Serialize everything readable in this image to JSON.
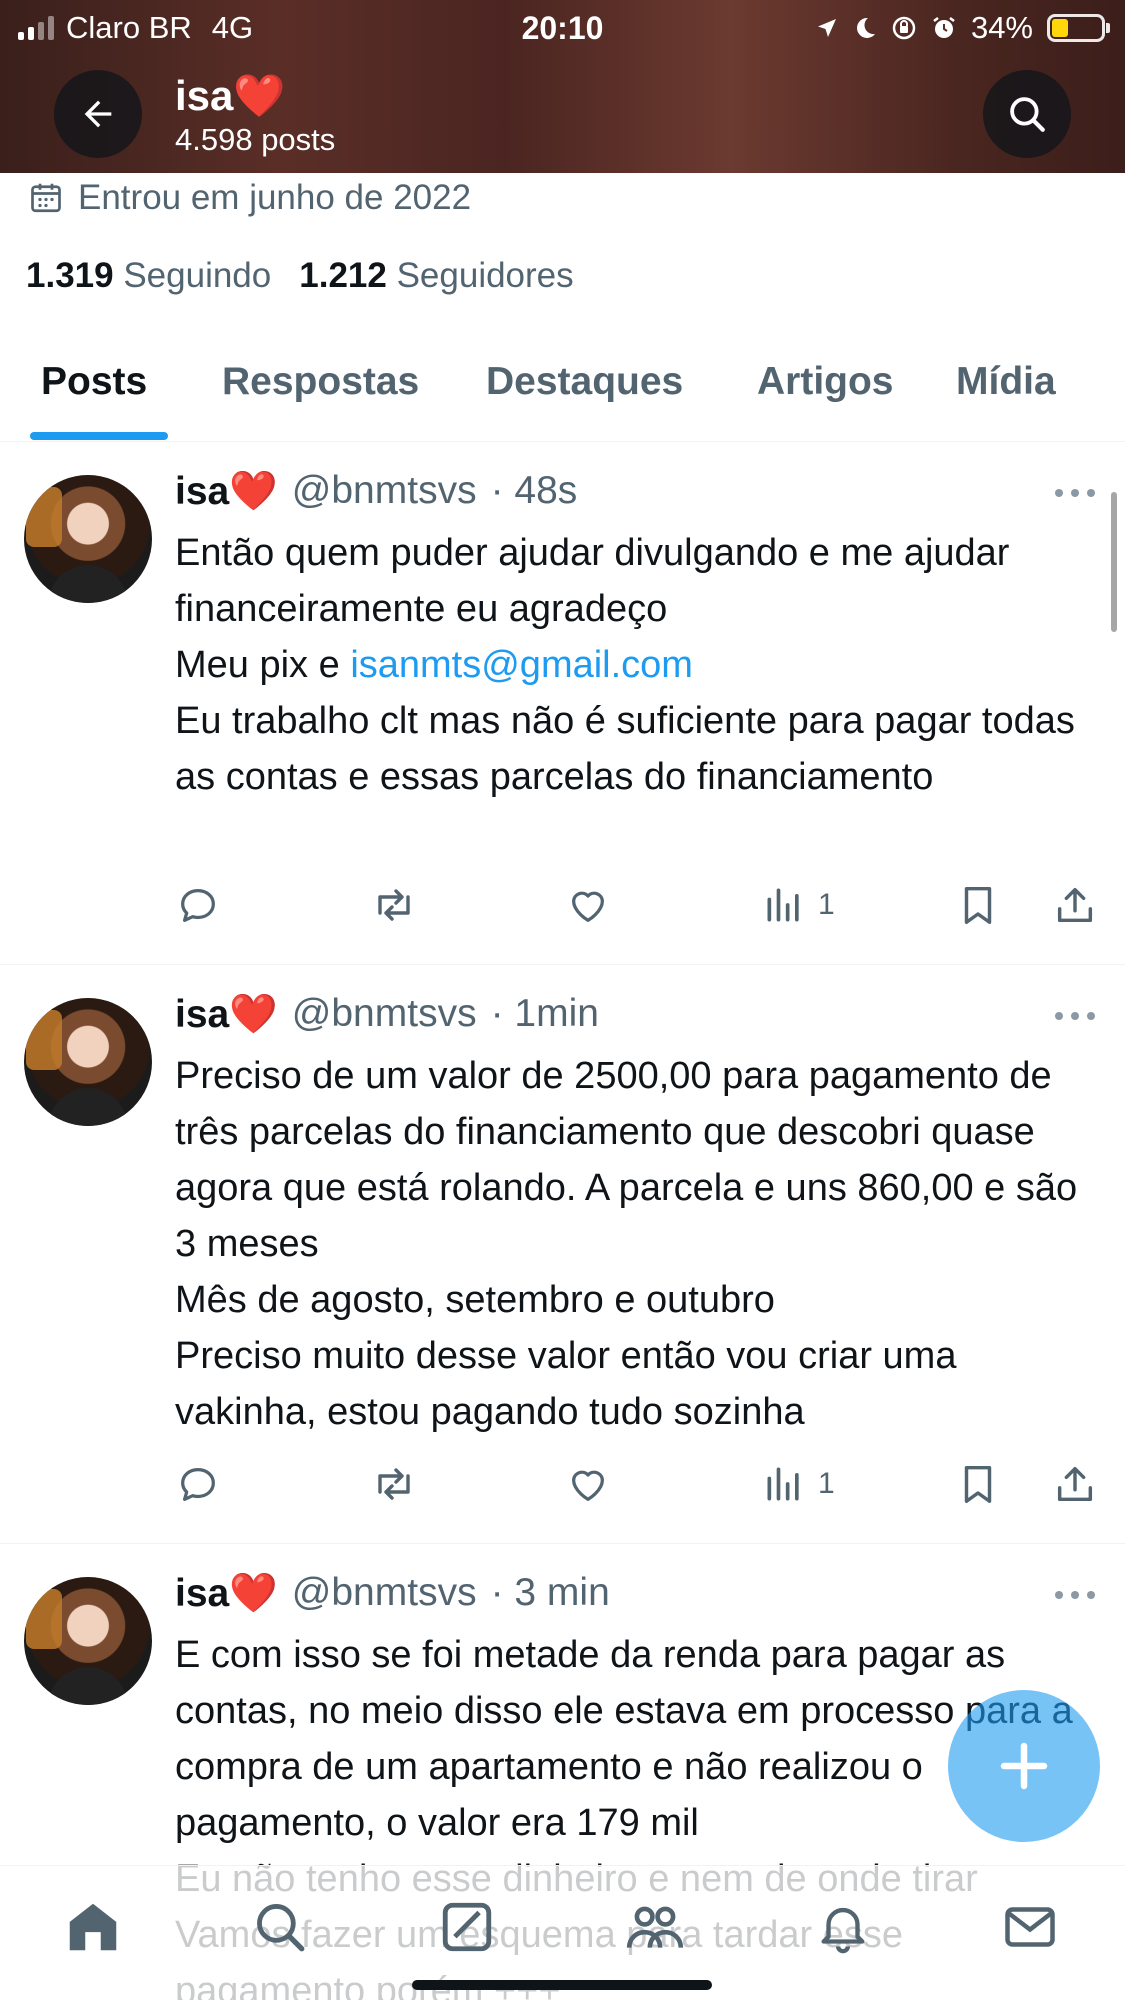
{
  "status_bar": {
    "carrier": "Claro BR",
    "network": "4G",
    "time": "20:10",
    "battery": "34%",
    "icons": [
      "location-icon",
      "moon-icon",
      "rotation-lock-icon",
      "alarm-icon",
      "battery-charging-icon"
    ]
  },
  "header": {
    "title": "isa❤️",
    "subtitle": "4.598 posts"
  },
  "profile": {
    "joined": "Entrou em junho de 2022",
    "following_count": "1.319",
    "following_label": "Seguindo",
    "followers_count": "1.212",
    "followers_label": "Seguidores"
  },
  "tabs": [
    {
      "label": "Posts",
      "active": true
    },
    {
      "label": "Respostas",
      "active": false
    },
    {
      "label": "Destaques",
      "active": false
    },
    {
      "label": "Artigos",
      "active": false
    },
    {
      "label": "Mídia",
      "active": false
    }
  ],
  "posts": [
    {
      "name": "isa❤️",
      "handle": "@bnmtsvs",
      "time": "· 48s",
      "text_before_link": "Então quem puder ajudar divulgando e me ajudar financeiramente eu agradeço\nMeu pix e ",
      "link": "isanmts@gmail.com",
      "text_after_link": "\nEu trabalho clt mas não é suficiente para pagar todas as contas e essas parcelas do financiamento",
      "views": "1"
    },
    {
      "name": "isa❤️",
      "handle": "@bnmtsvs",
      "time": "· 1min",
      "text": "Preciso de um valor de 2500,00 para pagamento de três parcelas do financiamento que descobri quase agora que está rolando. A parcela e uns 860,00 e são 3 meses\nMês de agosto, setembro e outubro\nPreciso muito desse valor então vou criar uma vakinha, estou pagando tudo sozinha",
      "views": "1"
    },
    {
      "name": "isa❤️",
      "handle": "@bnmtsvs",
      "time": "· 3 min",
      "text": "E com isso se foi metade da renda para pagar as contas, no meio disso ele estava em processo para a compra de um apartamento e não realizou o pagamento, o valor era 179 mil\nEu não tenho esse dinheiro e nem de onde tirar\nVamos fazer um esquema para tardar esse pagamento porém +++"
    }
  ],
  "colors": {
    "accent": "#1d9bf0",
    "text_primary": "#0f1419",
    "text_secondary": "#536471"
  },
  "bottom_nav": [
    "home-icon",
    "search-icon",
    "grok-icon",
    "communities-icon",
    "notifications-icon",
    "messages-icon"
  ]
}
